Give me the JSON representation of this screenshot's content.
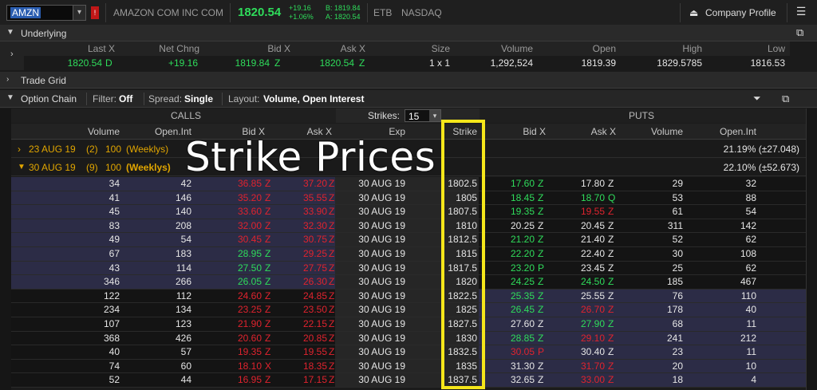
{
  "topbar": {
    "symbol": "AMZN",
    "company": "AMAZON COM INC COM",
    "last": "1820.54",
    "net_change": "+19.16",
    "pct_change": "+1.06%",
    "bid_quote": "B: 1819.84",
    "ask_quote": "A: 1820.54",
    "etb": "ETB",
    "exchange": "NASDAQ",
    "company_profile": "Company Profile",
    "colors": {
      "up": "#2fdc5b",
      "down": "#e0232e",
      "accent": "#e0a500"
    }
  },
  "underlying": {
    "title": "Underlying",
    "headers": [
      "Last X",
      "Net Chng",
      "Bid X",
      "Ask X",
      "Size",
      "Volume",
      "Open",
      "High",
      "Low"
    ],
    "values": {
      "last": "1820.54",
      "last_ex": "D",
      "net_chng": "+19.16",
      "bid": "1819.84",
      "bid_ex": "Z",
      "ask": "1820.54",
      "ask_ex": "Z",
      "size": "1 x 1",
      "volume": "1,292,524",
      "open": "1819.39",
      "high": "1829.5785",
      "low": "1816.53"
    }
  },
  "trade_grid": {
    "title": "Trade Grid"
  },
  "option_chain": {
    "title": "Option Chain",
    "filter_label": "Filter:",
    "filter_value": "Off",
    "spread_label": "Spread:",
    "spread_value": "Single",
    "layout_label": "Layout:",
    "layout_value": "Volume, Open Interest",
    "calls": "CALLS",
    "puts": "PUTS",
    "strikes_label": "Strikes:",
    "strikes_value": "15",
    "headers": {
      "volume": "Volume",
      "open_int": "Open.Int",
      "bid": "Bid X",
      "ask": "Ask X",
      "exp": "Exp",
      "strike": "Strike"
    },
    "expirations": [
      {
        "date": "23 AUG 19",
        "count": "(2)",
        "mult": "100",
        "tag": "(Weeklys)",
        "iv": "21.19% (±27.048)"
      },
      {
        "date": "30 AUG 19",
        "count": "(9)",
        "mult": "100",
        "tag": "(Weeklys)",
        "iv": "22.10% (±52.673)"
      }
    ],
    "rows": [
      {
        "cv": "34",
        "coi": "42",
        "cb": "36.85",
        "cbx": "Z",
        "ca": "37.20",
        "cax": "Z",
        "exp": "30 AUG 19",
        "strike": "1802.5",
        "pb": "17.60",
        "pbx": "Z",
        "pa": "17.80",
        "pax": "Z",
        "pv": "29",
        "poi": "32"
      },
      {
        "cv": "41",
        "coi": "146",
        "cb": "35.20",
        "cbx": "Z",
        "ca": "35.55",
        "cax": "Z",
        "exp": "30 AUG 19",
        "strike": "1805",
        "pb": "18.45",
        "pbx": "Z",
        "pa": "18.70",
        "pax": "Q",
        "pv": "53",
        "poi": "88"
      },
      {
        "cv": "45",
        "coi": "140",
        "cb": "33.60",
        "cbx": "Z",
        "ca": "33.90",
        "cax": "Z",
        "exp": "30 AUG 19",
        "strike": "1807.5",
        "pb": "19.35",
        "pbx": "Z",
        "pa": "19.55",
        "pax": "Z",
        "pv": "61",
        "poi": "54"
      },
      {
        "cv": "83",
        "coi": "208",
        "cb": "32.00",
        "cbx": "Z",
        "ca": "32.30",
        "cax": "Z",
        "exp": "30 AUG 19",
        "strike": "1810",
        "pb": "20.25",
        "pbx": "Z",
        "pa": "20.45",
        "pax": "Z",
        "pv": "311",
        "poi": "142"
      },
      {
        "cv": "49",
        "coi": "54",
        "cb": "30.45",
        "cbx": "Z",
        "ca": "30.75",
        "cax": "Z",
        "exp": "30 AUG 19",
        "strike": "1812.5",
        "pb": "21.20",
        "pbx": "Z",
        "pa": "21.40",
        "pax": "Z",
        "pv": "52",
        "poi": "62"
      },
      {
        "cv": "67",
        "coi": "183",
        "cb": "28.95",
        "cbx": "Z",
        "ca": "29.25",
        "cax": "Z",
        "exp": "30 AUG 19",
        "strike": "1815",
        "pb": "22.20",
        "pbx": "Z",
        "pa": "22.40",
        "pax": "Z",
        "pv": "30",
        "poi": "108"
      },
      {
        "cv": "43",
        "coi": "114",
        "cb": "27.50",
        "cbx": "Z",
        "ca": "27.75",
        "cax": "Z",
        "exp": "30 AUG 19",
        "strike": "1817.5",
        "pb": "23.20",
        "pbx": "P",
        "pa": "23.45",
        "pax": "Z",
        "pv": "25",
        "poi": "62"
      },
      {
        "cv": "346",
        "coi": "266",
        "cb": "26.05",
        "cbx": "Z",
        "ca": "26.30",
        "cax": "Z",
        "exp": "30 AUG 19",
        "strike": "1820",
        "pb": "24.25",
        "pbx": "Z",
        "pa": "24.50",
        "pax": "Z",
        "pv": "185",
        "poi": "467"
      },
      {
        "cv": "122",
        "coi": "112",
        "cb": "24.60",
        "cbx": "Z",
        "ca": "24.85",
        "cax": "Z",
        "exp": "30 AUG 19",
        "strike": "1822.5",
        "pb": "25.35",
        "pbx": "Z",
        "pa": "25.55",
        "pax": "Z",
        "pv": "76",
        "poi": "110"
      },
      {
        "cv": "234",
        "coi": "134",
        "cb": "23.25",
        "cbx": "Z",
        "ca": "23.50",
        "cax": "Z",
        "exp": "30 AUG 19",
        "strike": "1825",
        "pb": "26.45",
        "pbx": "Z",
        "pa": "26.70",
        "pax": "Z",
        "pv": "178",
        "poi": "40"
      },
      {
        "cv": "107",
        "coi": "123",
        "cb": "21.90",
        "cbx": "Z",
        "ca": "22.15",
        "cax": "Z",
        "exp": "30 AUG 19",
        "strike": "1827.5",
        "pb": "27.60",
        "pbx": "Z",
        "pa": "27.90",
        "pax": "Z",
        "pv": "68",
        "poi": "11"
      },
      {
        "cv": "368",
        "coi": "426",
        "cb": "20.60",
        "cbx": "Z",
        "ca": "20.85",
        "cax": "Z",
        "exp": "30 AUG 19",
        "strike": "1830",
        "pb": "28.85",
        "pbx": "Z",
        "pa": "29.10",
        "pax": "Z",
        "pv": "241",
        "poi": "212"
      },
      {
        "cv": "40",
        "coi": "57",
        "cb": "19.35",
        "cbx": "Z",
        "ca": "19.55",
        "cax": "Z",
        "exp": "30 AUG 19",
        "strike": "1832.5",
        "pb": "30.05",
        "pbx": "P",
        "pa": "30.40",
        "pax": "Z",
        "pv": "23",
        "poi": "11"
      },
      {
        "cv": "74",
        "coi": "60",
        "cb": "18.10",
        "cbx": "X",
        "ca": "18.35",
        "cax": "Z",
        "exp": "30 AUG 19",
        "strike": "1835",
        "pb": "31.30",
        "pbx": "Z",
        "pa": "31.70",
        "pax": "Z",
        "pv": "20",
        "poi": "10"
      },
      {
        "cv": "52",
        "coi": "44",
        "cb": "16.95",
        "cbx": "Z",
        "ca": "17.15",
        "cax": "Z",
        "exp": "30 AUG 19",
        "strike": "1837.5",
        "pb": "32.65",
        "pbx": "Z",
        "pa": "33.00",
        "pax": "Z",
        "pv": "18",
        "poi": "4"
      }
    ],
    "row_colors": {
      "cb": [
        "red",
        "red",
        "red",
        "red",
        "red",
        "green",
        "green",
        "green",
        "red",
        "red",
        "red",
        "red",
        "red",
        "red",
        "red"
      ],
      "ca": [
        "red",
        "red",
        "red",
        "red",
        "red",
        "red",
        "red",
        "red",
        "red",
        "red",
        "red",
        "red",
        "red",
        "red",
        "red"
      ],
      "pb": [
        "green",
        "green",
        "green",
        "white",
        "green",
        "green",
        "green",
        "green",
        "green",
        "green",
        "white",
        "green",
        "red",
        "white",
        "white"
      ],
      "pa": [
        "white",
        "green",
        "red",
        "white",
        "white",
        "white",
        "white",
        "green",
        "white",
        "red",
        "green",
        "red",
        "white",
        "red",
        "red"
      ]
    }
  },
  "overlay": {
    "title": "Strike Prices"
  }
}
